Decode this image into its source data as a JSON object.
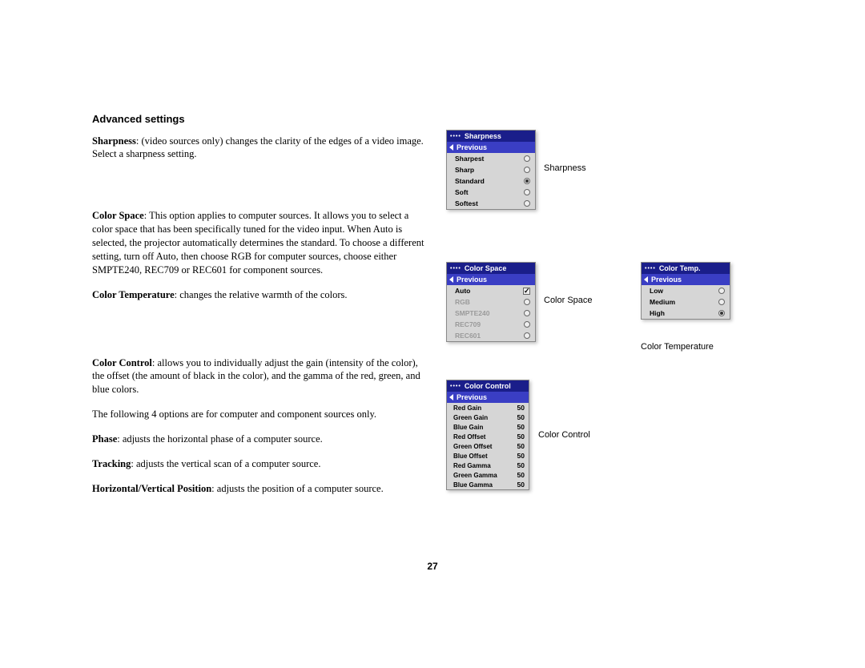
{
  "section_title": "Advanced settings",
  "p_sharpness_bold": "Sharpness",
  "p_sharpness_text": ": (video sources only) changes the clarity of the edges of a video image. Select a sharpness setting.",
  "p_colorspace_bold": "Color Space",
  "p_colorspace_text": ": This option applies to computer sources. It allows you to select a color space that has been specifically tuned for the video input. When Auto is selected, the projector automatically determines the standard. To choose a different setting, turn off Auto, then choose RGB for computer sources, choose either SMPTE240, REC709 or REC601 for component sources.",
  "p_colortemp_bold": "Color Temperature",
  "p_colortemp_text": ": changes the relative warmth of the colors.",
  "p_colorcontrol_bold": "Color Control",
  "p_colorcontrol_text": ": allows you to individually adjust the gain (intensity of the color), the offset (the amount of black in the color), and the gamma of the red, green, and blue colors.",
  "p_following4": "The following 4 options are for computer and component sources only.",
  "p_phase_bold": "Phase",
  "p_phase_text": ": adjusts the horizontal phase of a computer source.",
  "p_tracking_bold": "Tracking",
  "p_tracking_text": ": adjusts the vertical scan of a computer source.",
  "p_hvpos_bold": "Horizontal/Vertical Position",
  "p_hvpos_text": ": adjusts the position of a computer source.",
  "page_number": "27",
  "cap_sharpness": "Sharpness",
  "cap_colorspace": "Color Space",
  "cap_colortemp": "Color Temperature",
  "cap_colorcontrol": "Color Control",
  "osd": {
    "previous": "Previous",
    "sharpness": {
      "title": "Sharpness",
      "items": [
        "Sharpest",
        "Sharp",
        "Standard",
        "Soft",
        "Softest"
      ],
      "selected_index": 2
    },
    "colorspace": {
      "title": "Color Space",
      "auto": "Auto",
      "auto_checked": true,
      "items": [
        "RGB",
        "SMPTE240",
        "REC709",
        "REC601"
      ]
    },
    "colortemp": {
      "title": "Color Temp.",
      "items": [
        "Low",
        "Medium",
        "High"
      ],
      "selected_index": 2
    },
    "colorcontrol": {
      "title": "Color Control",
      "rows": [
        {
          "label": "Red Gain",
          "value": 50
        },
        {
          "label": "Green Gain",
          "value": 50
        },
        {
          "label": "Blue Gain",
          "value": 50
        },
        {
          "label": "Red Offset",
          "value": 50
        },
        {
          "label": "Green Offset",
          "value": 50
        },
        {
          "label": "Blue Offset",
          "value": 50
        },
        {
          "label": "Red Gamma",
          "value": 50
        },
        {
          "label": "Green Gamma",
          "value": 50
        },
        {
          "label": "Blue Gamma",
          "value": 50
        }
      ]
    }
  }
}
